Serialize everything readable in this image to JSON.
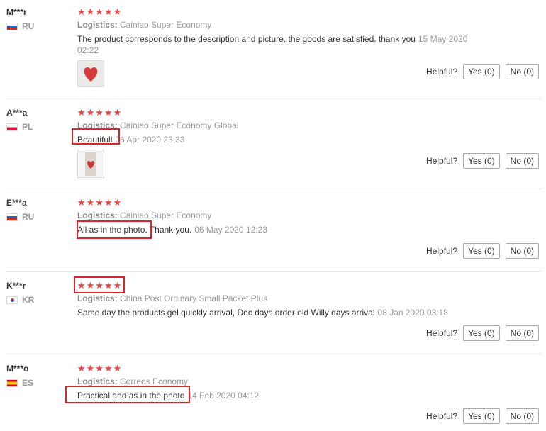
{
  "helpful_label": "Helpful?",
  "logistics_label": "Logistics:",
  "reviews": [
    {
      "user": "M***r",
      "country": "RU",
      "flag": "ru",
      "stars": "★★★★★",
      "logistics": "Cainiao Super Economy",
      "text": "The product corresponds to the description and picture. the goods are satisfied. thank you",
      "date": "15 May 2020 02:22",
      "yes": "Yes (0)",
      "no": "No (0)",
      "has_photo": true
    },
    {
      "user": "A***a",
      "country": "PL",
      "flag": "pl",
      "stars": "★★★★★",
      "logistics": "Cainiao Super Economy Global",
      "text": "Beautifull",
      "date": "06 Apr 2020 23:33",
      "yes": "Yes (0)",
      "no": "No (0)",
      "has_photo": true
    },
    {
      "user": "E***a",
      "country": "RU",
      "flag": "ru",
      "stars": "★★★★★",
      "logistics": "Cainiao Super Economy",
      "text": "All as in the photo. Thank you.",
      "date": "06 May 2020 12:23",
      "yes": "Yes (0)",
      "no": "No (0)",
      "has_photo": false
    },
    {
      "user": "K***r",
      "country": "KR",
      "flag": "kr",
      "stars": "★★★★★",
      "logistics": "China Post Ordinary Small Packet Plus",
      "text": "Same day the products gel quickly arrival, Dec days order old Willy days arrival",
      "date": "08 Jan 2020 03:18",
      "yes": "Yes (0)",
      "no": "No (0)",
      "has_photo": false
    },
    {
      "user": "M***o",
      "country": "ES",
      "flag": "es",
      "stars": "★★★★★",
      "logistics": "Correos Economy",
      "text": "Practical and as in the photo",
      "date": "14 Feb 2020 04:12",
      "yes": "Yes (0)",
      "no": "No (0)",
      "has_photo": false
    }
  ],
  "colors": {
    "star": "#e64545",
    "highlight": "#d9262c",
    "heart": "#d63b3b"
  }
}
